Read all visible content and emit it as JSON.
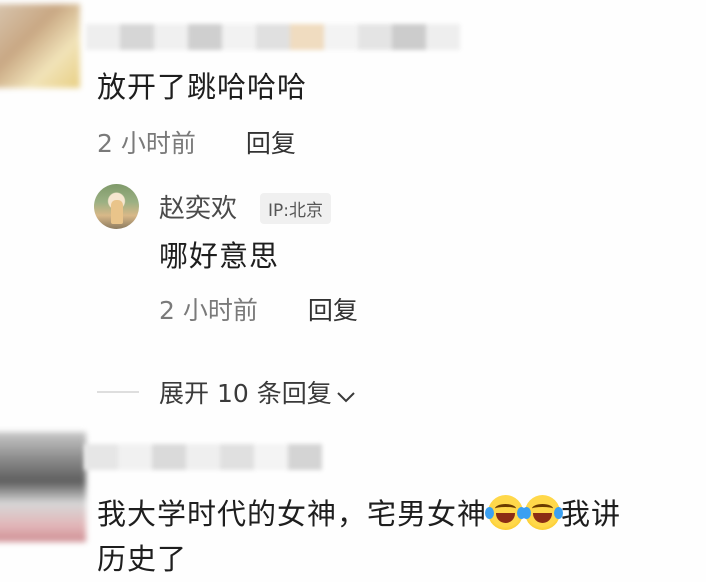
{
  "comment1": {
    "text": "放开了跳哈哈哈",
    "time": "2 小时前",
    "reply_label": "回复"
  },
  "reply": {
    "author": "赵奕欢",
    "ip": "IP:北京",
    "text": "哪好意思",
    "time": "2 小时前",
    "reply_label": "回复"
  },
  "expand": {
    "label": "展开 10 条回复"
  },
  "comment2": {
    "text_a": "我大学时代的女神，宅男女神",
    "emoji_1": "laughing-crying-emoji",
    "emoji_2": "laughing-crying-emoji",
    "text_b": "我讲",
    "text_c": "历史了"
  },
  "colors": {
    "meta_gray": "#7a7a7a",
    "badge_bg": "#f0f0f0",
    "body_text": "#1e1e1e"
  }
}
